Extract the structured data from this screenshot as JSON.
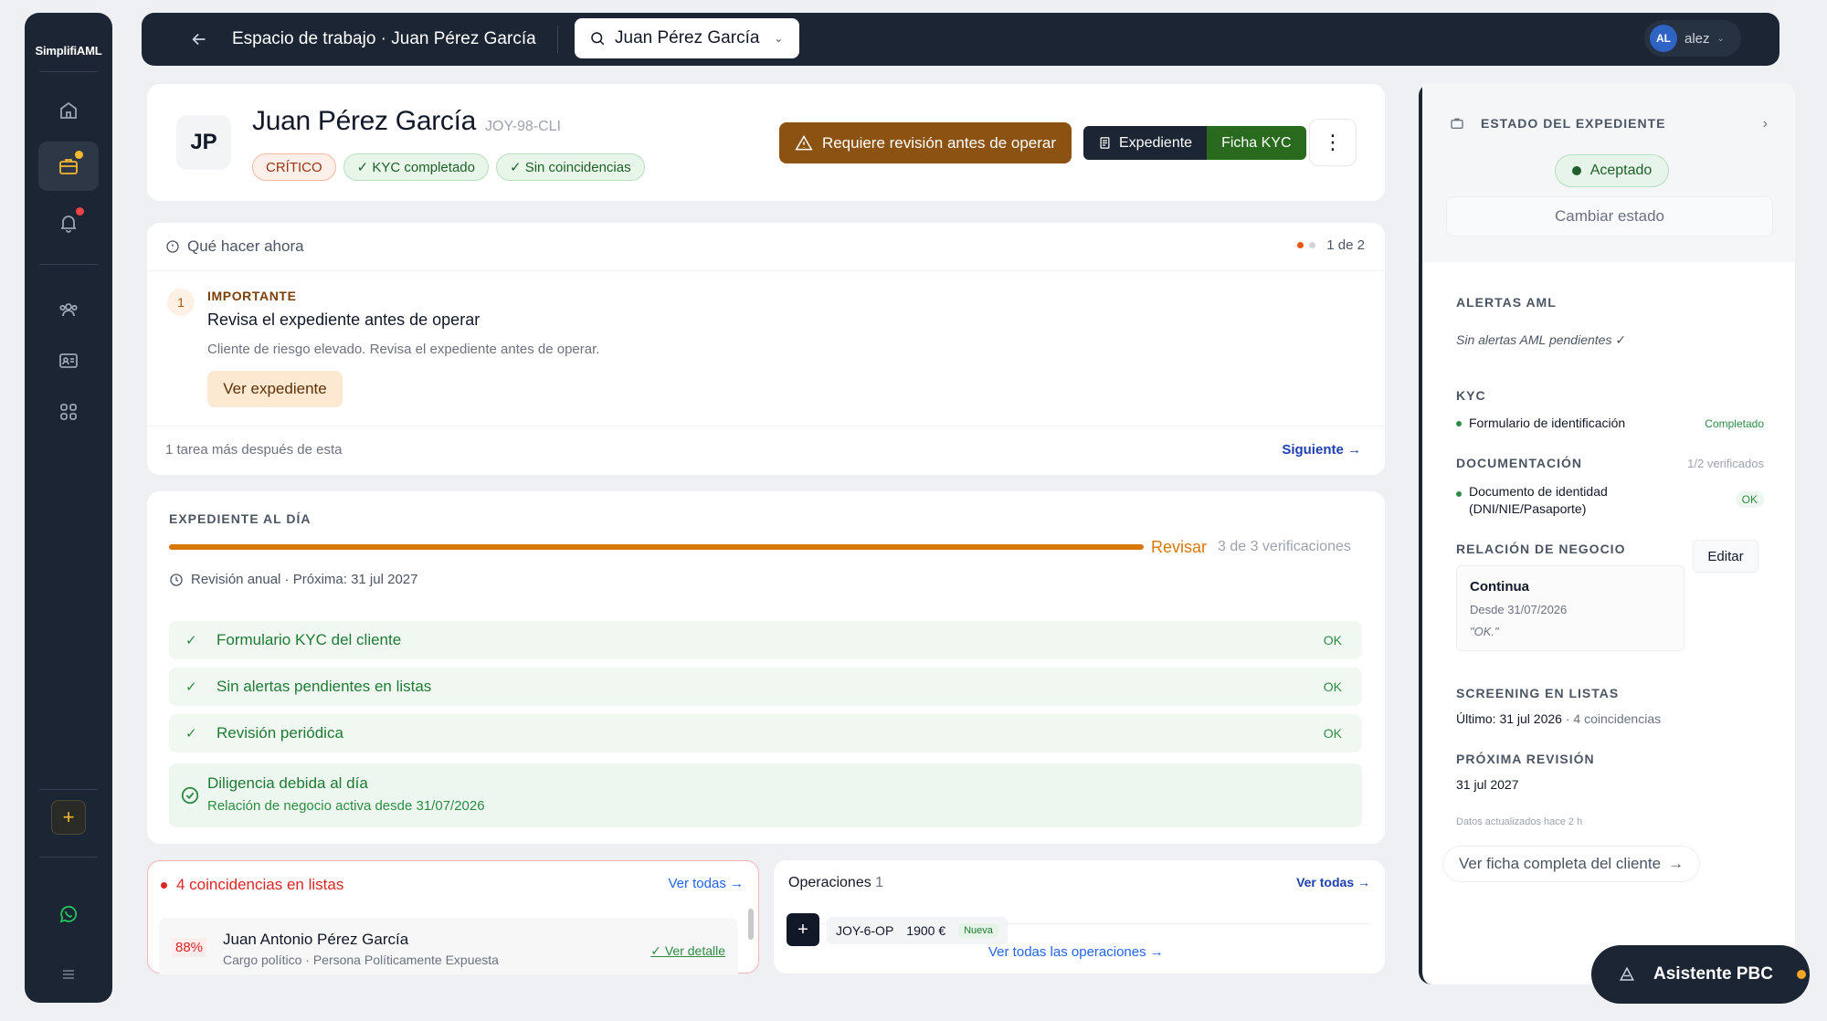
{
  "colors": {
    "sidebar_bg": "#1b2533",
    "accent_warning": "#8b5212",
    "success": "#2e8b45",
    "danger": "#dc2626",
    "link": "#2563eb",
    "progress": "#d97706"
  },
  "sidebar": {
    "brand": "SimplifiAML",
    "items": [
      {
        "icon": "home-icon"
      },
      {
        "icon": "briefcase-icon",
        "active": true
      },
      {
        "icon": "bell-icon",
        "badge": true
      },
      {
        "icon": "users-icon"
      },
      {
        "icon": "id-card-icon"
      },
      {
        "icon": "grid-icon"
      }
    ],
    "add_label": "+",
    "whatsapp_icon": "whatsapp-icon",
    "menu_icon": "menu-icon"
  },
  "topbar": {
    "breadcrumb": "Espacio de trabajo · Juan Pérez García",
    "client_select": "Juan Pérez García",
    "user_initials": "AL",
    "user_name": "alez"
  },
  "client": {
    "initials": "JP",
    "name": "Juan Pérez García",
    "code": "JOY-98-CLI",
    "chips": [
      "CRÍTICO",
      "✓ KYC completado",
      "✓ Sin coincidencias"
    ],
    "warning_button": "Requiere revisión antes de operar",
    "expediente_button": "Expediente",
    "ficha_button": "Ficha KYC"
  },
  "todo": {
    "heading": "Qué hacer ahora",
    "count": "1 de 2",
    "step_number": "1",
    "priority": "IMPORTANTE",
    "title": "Revisa el expediente antes de operar",
    "description": "Cliente de riesgo elevado. Revisa el expediente antes de operar.",
    "action": "Ver expediente",
    "footer": "1 tarea más después de esta",
    "next": "Siguiente →"
  },
  "expediente": {
    "label": "EXPEDIENTE AL DÍA",
    "progress_fraction": 1.0,
    "status": "Revisar",
    "verifications": "3 de 3 verificaciones",
    "review": "Revisión anual · Próxima: 31 jul 2027",
    "checks": [
      {
        "label": "Formulario KYC del cliente",
        "status": "OK"
      },
      {
        "label": "Sin alertas pendientes en listas",
        "status": "OK"
      },
      {
        "label": "Revisión periódica",
        "status": "OK"
      }
    ],
    "diligence_title": "Diligencia debida al día",
    "diligence_sub": "Relación de negocio activa desde 31/07/2026"
  },
  "coincidences": {
    "title": "4 coincidencias en listas",
    "see_all": "Ver todas →",
    "item": {
      "percent": "88%",
      "name": "Juan Antonio Pérez García",
      "sub": "Cargo político · Persona Políticamente Expuesta",
      "detail": "✓ Ver detalle"
    }
  },
  "operations": {
    "title": "Operaciones",
    "count": "1",
    "see_all": "Ver todas →",
    "row": {
      "code": "JOY-6-OP",
      "amount": "1900 €",
      "badge": "Nueva"
    },
    "see_all_ops": "Ver todas las operaciones →"
  },
  "panel": {
    "state_label": "ESTADO DEL EXPEDIENTE",
    "state": "Aceptado",
    "change_state": "Cambiar estado",
    "aml_label": "ALERTAS AML",
    "aml_text": "Sin alertas AML pendientes ✓",
    "kyc_label": "KYC",
    "kyc_item": "Formulario de identificación",
    "kyc_status": "Completado",
    "doc_label": "DOCUMENTACIÓN",
    "doc_verified": "1/2 verificados",
    "doc_item_1": "Documento de identidad",
    "doc_item_2": "(DNI/NIE/Pasaporte)",
    "doc_status": "OK",
    "rel_label": "RELACIÓN DE NEGOCIO",
    "edit": "Editar",
    "rel_title": "Continua",
    "rel_since": "Desde 31/07/2026",
    "rel_note": "\"OK.\"",
    "screening_label": "SCREENING EN LISTAS",
    "screening_last": "Último: 31 jul 2026",
    "screening_matches": " · 4 coincidencias",
    "next_label": "PRÓXIMA REVISIÓN",
    "next_date": "31 jul 2027",
    "updated": "Datos actualizados hace 2 h",
    "full_link": "Ver ficha completa del cliente",
    "full_link_arrow": "→"
  },
  "assistant": "Asistente PBC"
}
